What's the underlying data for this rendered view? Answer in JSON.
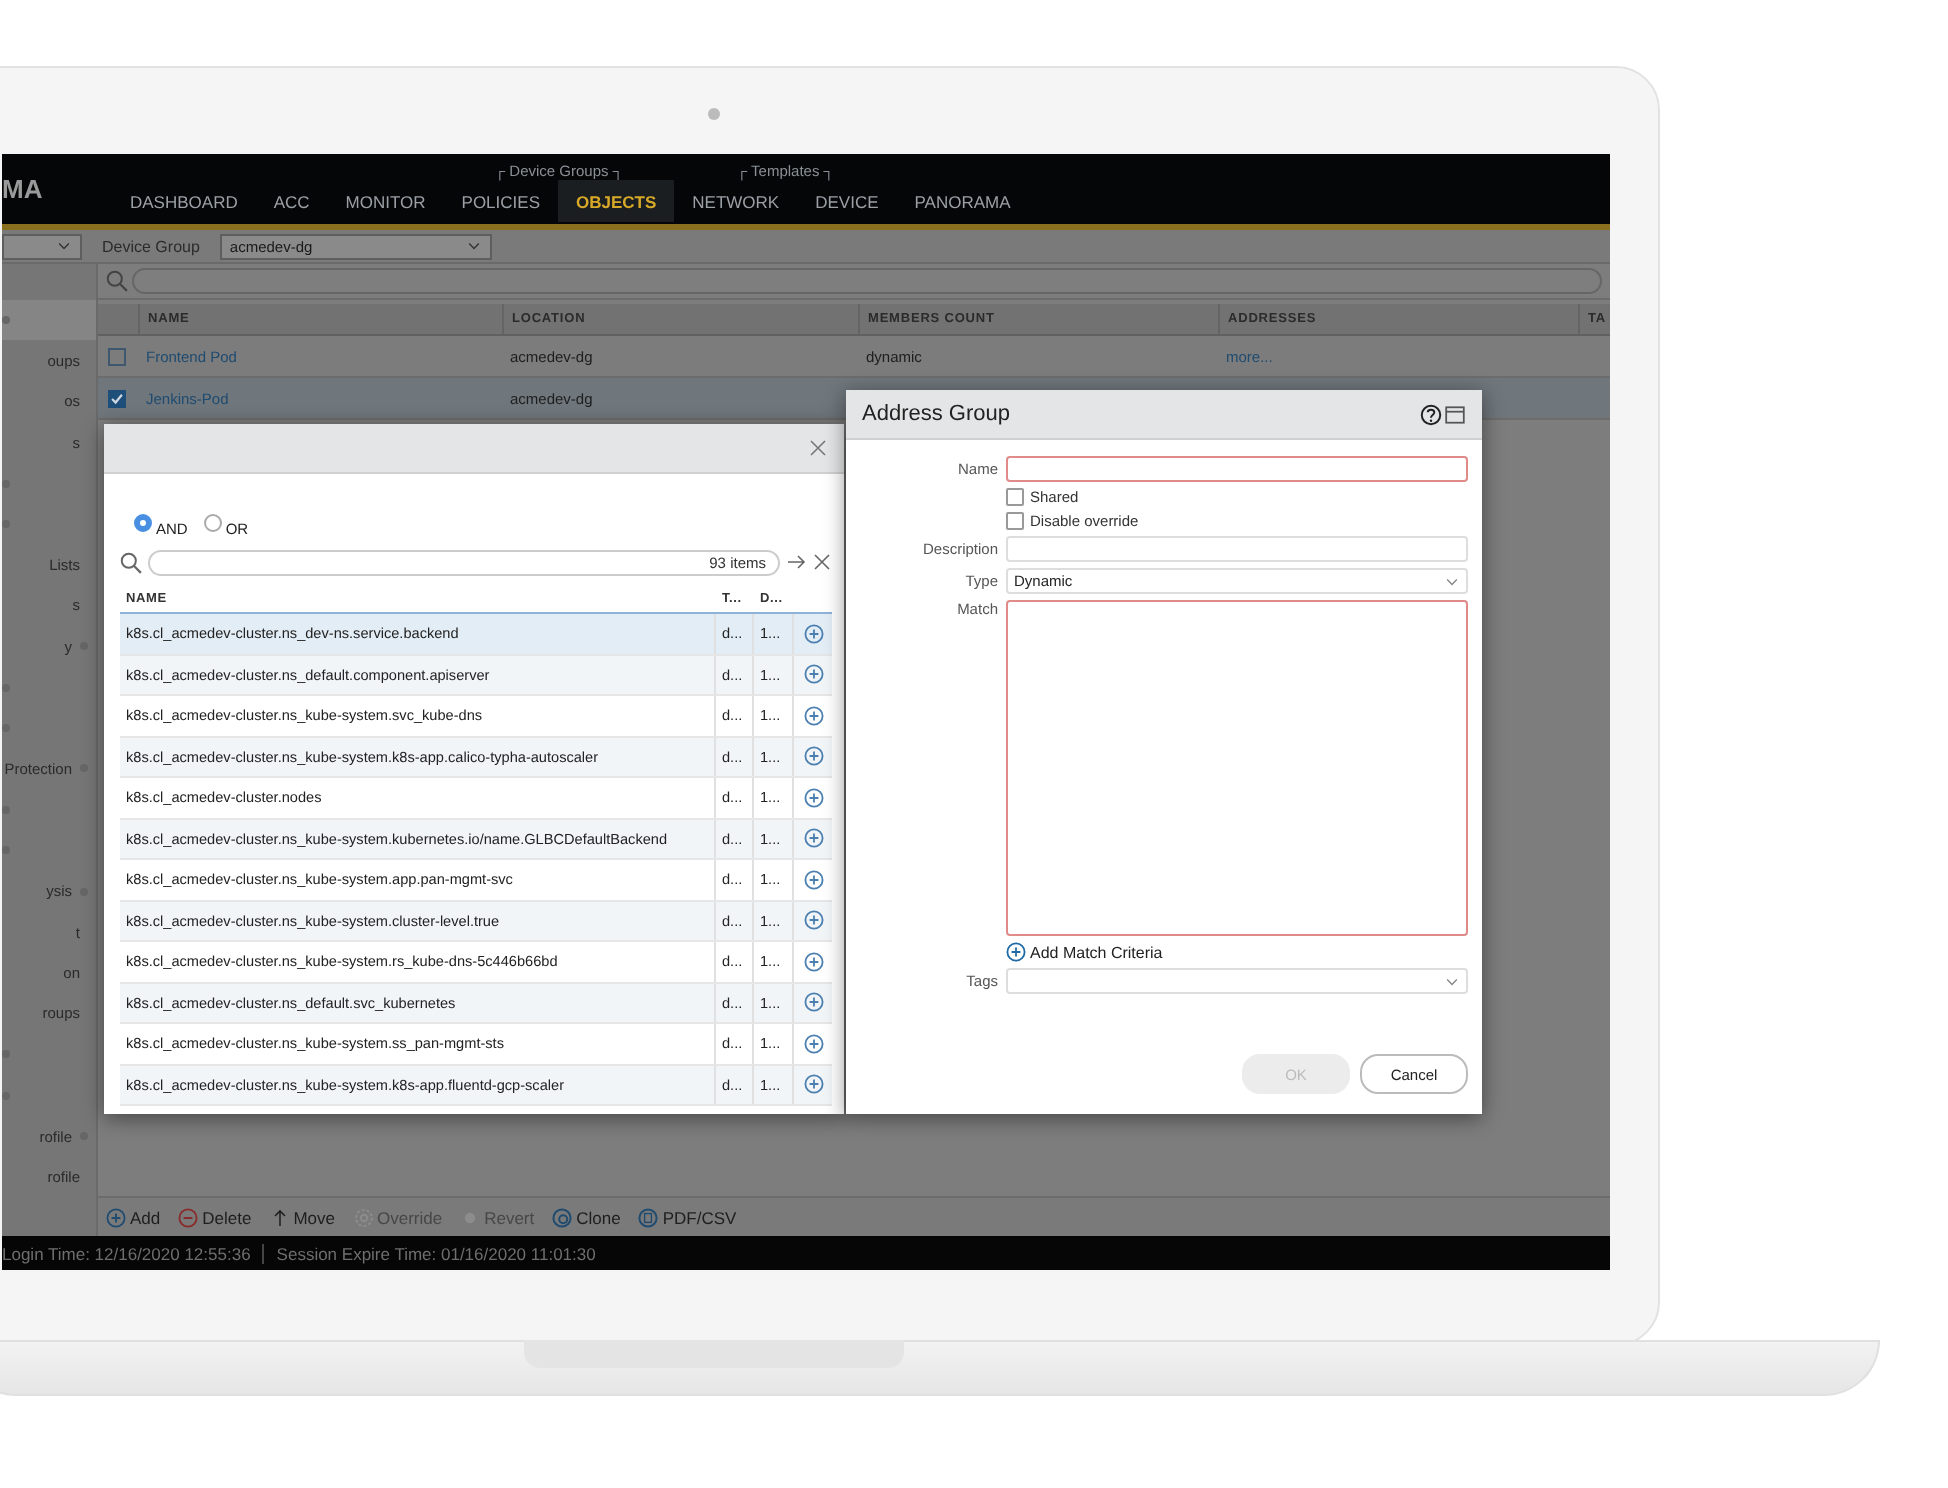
{
  "logo": "MA",
  "nav": [
    {
      "kind": "tab",
      "label": "DASHBOARD",
      "selected": false
    },
    {
      "kind": "tab",
      "label": "ACC",
      "selected": false
    },
    {
      "kind": "tab",
      "label": "MONITOR",
      "selected": false
    },
    {
      "kind": "group",
      "label": "┌ Device Groups ┐",
      "tabs": [
        {
          "label": "POLICIES",
          "selected": false
        },
        {
          "label": "OBJECTS",
          "selected": true
        }
      ]
    },
    {
      "kind": "group",
      "label": "┌ Templates ┐",
      "tabs": [
        {
          "label": "NETWORK",
          "selected": false
        },
        {
          "label": "DEVICE",
          "selected": false
        }
      ]
    },
    {
      "kind": "tab",
      "label": "PANORAMA",
      "selected": false
    }
  ],
  "device_group": {
    "label": "Device Group",
    "value": "acmedev-dg"
  },
  "sidebar": {
    "items": [
      {
        "dot": true,
        "selected": true
      },
      {
        "label": "oups",
        "dot": false,
        "selected": false
      },
      {
        "label": "os",
        "dot": false,
        "selected": false
      },
      {
        "label": "s",
        "dot": false,
        "selected": false
      },
      {
        "dot": true,
        "selected": false
      },
      {
        "dot": true,
        "selected": false
      },
      {
        "label": "Lists",
        "dot": false,
        "selected": false
      },
      {
        "label": "s",
        "dot": false,
        "selected": false
      },
      {
        "label": "y",
        "dot": true,
        "selected": false
      },
      {
        "dot": true,
        "selected": false
      },
      {
        "dot": true,
        "selected": false
      },
      {
        "label": "Protection",
        "dot": true,
        "selected": false
      },
      {
        "dot": true,
        "selected": false
      },
      {
        "dot": true,
        "selected": false
      },
      {
        "label": "ysis",
        "dot": true,
        "selected": false
      },
      {
        "label": "t",
        "dot": false,
        "selected": false
      },
      {
        "label": "on",
        "dot": false,
        "selected": false
      },
      {
        "label": "roups",
        "dot": false,
        "selected": false
      },
      {
        "dot": true,
        "selected": false
      },
      {
        "dot": true,
        "selected": false
      },
      {
        "label": "rofile",
        "dot": true,
        "selected": false
      },
      {
        "label": "rofile",
        "dot": false,
        "selected": false
      }
    ]
  },
  "table": {
    "columns": [
      "NAME",
      "LOCATION",
      "MEMBERS COUNT",
      "ADDRESSES",
      "TA"
    ],
    "rows": [
      {
        "checked": false,
        "selected": false,
        "cells": [
          "Frontend Pod",
          "acmedev-dg",
          "dynamic",
          "more..."
        ]
      },
      {
        "checked": true,
        "selected": true,
        "cells": [
          "Jenkins-Pod",
          "acmedev-dg"
        ]
      }
    ]
  },
  "actions": [
    {
      "label": "Add",
      "kind": "add",
      "disabled": false
    },
    {
      "label": "Delete",
      "kind": "delete",
      "disabled": false
    },
    {
      "label": "Move",
      "kind": "move",
      "disabled": false
    },
    {
      "label": "Override",
      "kind": "override",
      "disabled": true
    },
    {
      "label": "Revert",
      "kind": "revert",
      "disabled": true
    },
    {
      "label": "Clone",
      "kind": "clone",
      "disabled": false
    },
    {
      "label": "PDF/CSV",
      "kind": "pdf",
      "disabled": false
    }
  ],
  "status_bar": [
    "Login Time: 12/16/2020 12:55:36",
    "Session Expire Time: 01/16/2020 11:01:30"
  ],
  "picker": {
    "operators": [
      {
        "label": "AND",
        "selected": true
      },
      {
        "label": "OR",
        "selected": false
      }
    ],
    "count": "93 items",
    "columns": [
      "NAME",
      "T...",
      "D..."
    ],
    "rows": [
      {
        "name": "k8s.cl_acmedev-cluster.ns_dev-ns.service.backend",
        "t": "d...",
        "d": "1...",
        "selected": true
      },
      {
        "name": "k8s.cl_acmedev-cluster.ns_default.component.apiserver",
        "t": "d...",
        "d": "1...",
        "selected": false
      },
      {
        "name": "k8s.cl_acmedev-cluster.ns_kube-system.svc_kube-dns",
        "t": "d...",
        "d": "1...",
        "selected": false
      },
      {
        "name": "k8s.cl_acmedev-cluster.ns_kube-system.k8s-app.calico-typha-autoscaler",
        "t": "d...",
        "d": "1...",
        "selected": false
      },
      {
        "name": "k8s.cl_acmedev-cluster.nodes",
        "t": "d...",
        "d": "1...",
        "selected": false
      },
      {
        "name": "k8s.cl_acmedev-cluster.ns_kube-system.kubernetes.io/name.GLBCDefaultBackend",
        "t": "d...",
        "d": "1...",
        "selected": false
      },
      {
        "name": "k8s.cl_acmedev-cluster.ns_kube-system.app.pan-mgmt-svc",
        "t": "d...",
        "d": "1...",
        "selected": false
      },
      {
        "name": "k8s.cl_acmedev-cluster.ns_kube-system.cluster-level.true",
        "t": "d...",
        "d": "1...",
        "selected": false
      },
      {
        "name": "k8s.cl_acmedev-cluster.ns_kube-system.rs_kube-dns-5c446b66bd",
        "t": "d...",
        "d": "1...",
        "selected": false
      },
      {
        "name": "k8s.cl_acmedev-cluster.ns_default.svc_kubernetes",
        "t": "d...",
        "d": "1...",
        "selected": false
      },
      {
        "name": "k8s.cl_acmedev-cluster.ns_kube-system.ss_pan-mgmt-sts",
        "t": "d...",
        "d": "1...",
        "selected": false
      },
      {
        "name": "k8s.cl_acmedev-cluster.ns_kube-system.k8s-app.fluentd-gcp-scaler",
        "t": "d...",
        "d": "1...",
        "selected": false
      }
    ]
  },
  "dialog": {
    "title": "Address Group",
    "name_label": "Name",
    "checkboxes": [
      {
        "label": "Shared",
        "checked": false
      },
      {
        "label": "Disable override",
        "checked": false
      }
    ],
    "description_label": "Description",
    "type_label": "Type",
    "type_value": "Dynamic",
    "match_label": "Match",
    "add_criteria": "Add Match Criteria",
    "tags_label": "Tags",
    "buttons": [
      {
        "label": "OK",
        "disabled": true
      },
      {
        "label": "Cancel",
        "disabled": false
      }
    ]
  }
}
